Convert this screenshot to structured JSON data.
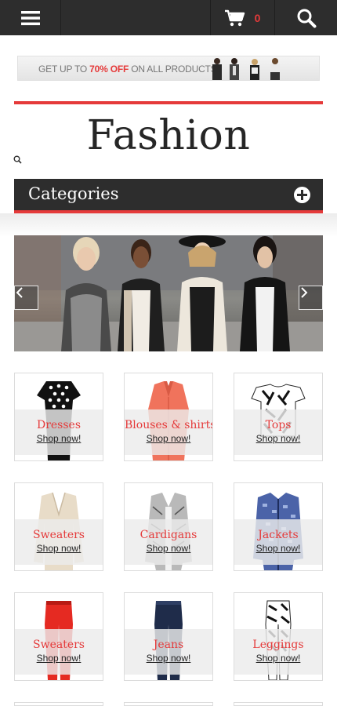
{
  "header": {
    "cart_count": "0"
  },
  "banner": {
    "prefix": "GET UP TO ",
    "highlight": "70% OFF",
    "suffix": " ON ALL PRODUCTS"
  },
  "logo": {
    "text": "Fashion"
  },
  "categories": {
    "title": "Categories"
  },
  "products": [
    {
      "name": "Dresses",
      "link": "Shop now!"
    },
    {
      "name": "Blouses & shirts",
      "link": "Shop now!"
    },
    {
      "name": "Tops",
      "link": "Shop now!"
    },
    {
      "name": "Sweaters",
      "link": "Shop now!"
    },
    {
      "name": "Cardigans",
      "link": "Shop now!"
    },
    {
      "name": "Jackets",
      "link": "Shop now!"
    },
    {
      "name": "Sweaters",
      "link": "Shop now!"
    },
    {
      "name": "Jeans",
      "link": "Shop now!"
    },
    {
      "name": "Leggings",
      "link": "Shop now!"
    }
  ],
  "colors": {
    "accent": "#e53a3a",
    "dark_bar": "#2d2d2d"
  }
}
